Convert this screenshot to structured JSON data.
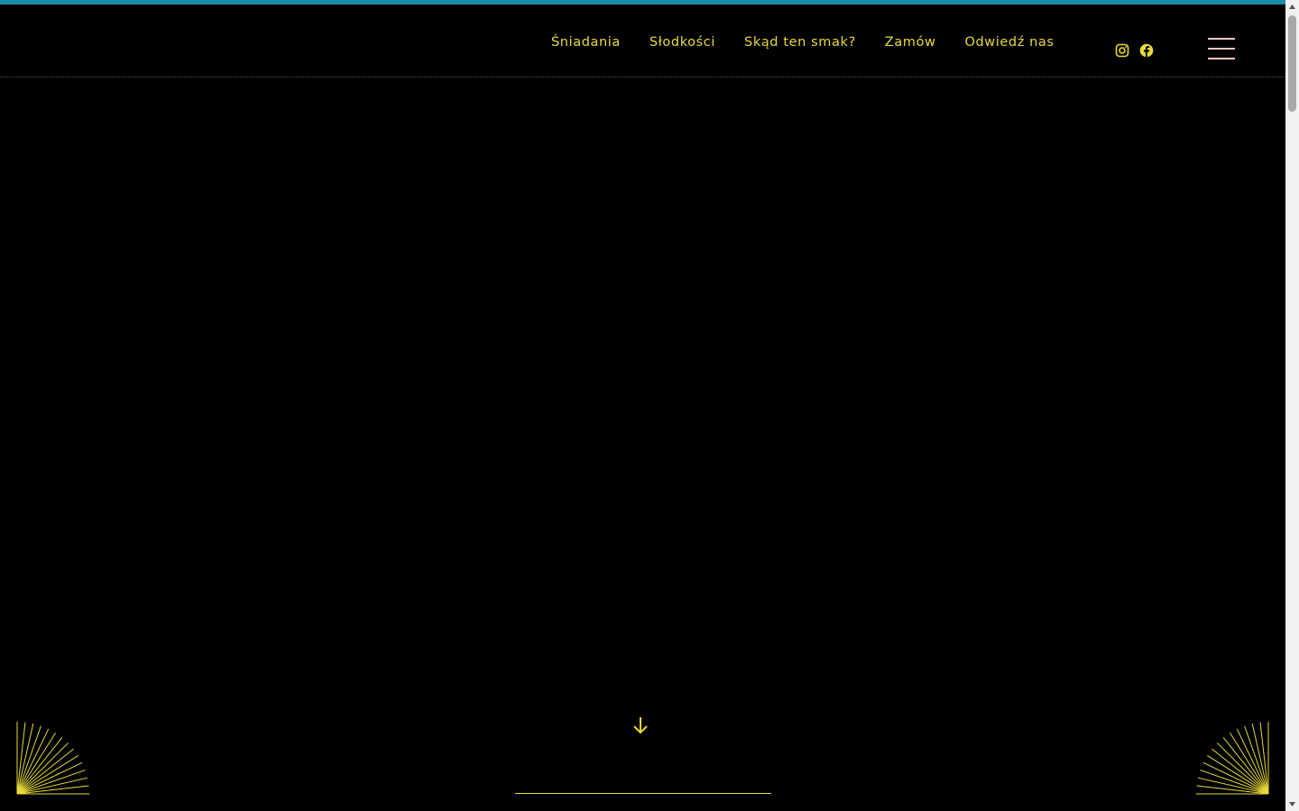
{
  "header": {
    "nav": [
      {
        "label": "Śniadania"
      },
      {
        "label": "Słodkości"
      },
      {
        "label": "Skąd ten smak?"
      },
      {
        "label": "Zamów"
      },
      {
        "label": "Odwiedź nas"
      }
    ],
    "social": [
      {
        "icon": "instagram-icon"
      },
      {
        "icon": "facebook-icon"
      }
    ],
    "menu_icon": "hamburger-menu-icon"
  },
  "hero": {
    "scroll_icon": "arrow-down-icon",
    "decor_icon": "sunburst-icon"
  },
  "colors": {
    "accent_bar": "#1a8fa8",
    "nav_text": "#e8da3a",
    "menu_icon": "#f2c9c4",
    "background": "#000000"
  }
}
